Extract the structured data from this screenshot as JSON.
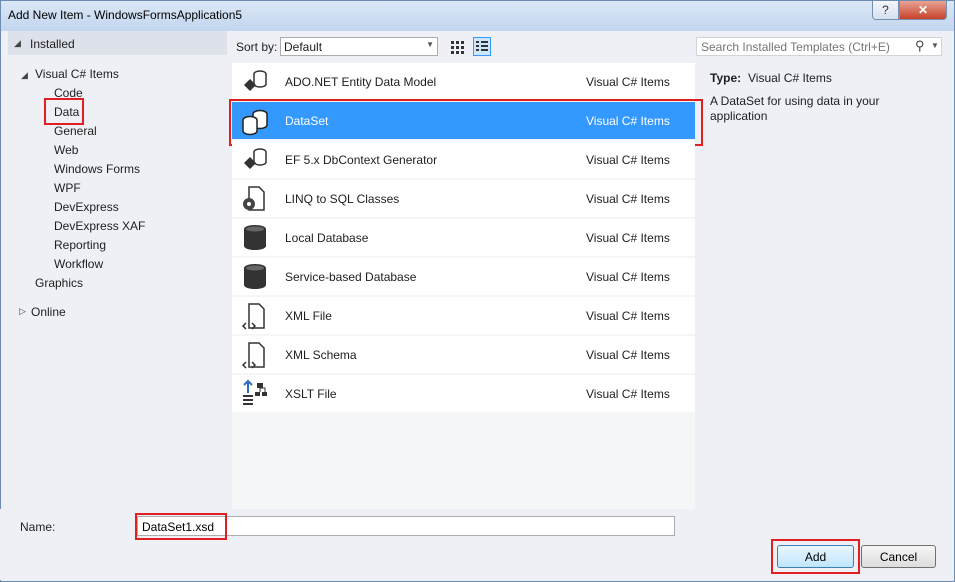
{
  "window": {
    "title": "Add New Item - WindowsFormsApplication5",
    "help_label": "?",
    "close_label": "✕"
  },
  "tree": {
    "installed": "Installed",
    "visual_csharp_items": "Visual C# Items",
    "children": [
      "Code",
      "Data",
      "General",
      "Web",
      "Windows Forms",
      "WPF",
      "DevExpress",
      "DevExpress XAF",
      "Reporting",
      "Workflow"
    ],
    "graphics": "Graphics",
    "online": "Online",
    "selected": "Data"
  },
  "toolbar": {
    "sort_label": "Sort by:",
    "sort_value": "Default"
  },
  "search": {
    "placeholder": "Search Installed Templates (Ctrl+E)"
  },
  "templates": [
    {
      "name": "ADO.NET Entity Data Model",
      "category": "Visual C# Items",
      "icon": "entity-model-icon"
    },
    {
      "name": "DataSet",
      "category": "Visual C# Items",
      "icon": "dataset-icon",
      "selected": true
    },
    {
      "name": "EF 5.x DbContext Generator",
      "category": "Visual C# Items",
      "icon": "entity-model-icon"
    },
    {
      "name": "LINQ to SQL Classes",
      "category": "Visual C# Items",
      "icon": "linq-icon"
    },
    {
      "name": "Local Database",
      "category": "Visual C# Items",
      "icon": "database-icon"
    },
    {
      "name": "Service-based Database",
      "category": "Visual C# Items",
      "icon": "database-icon"
    },
    {
      "name": "XML File",
      "category": "Visual C# Items",
      "icon": "xml-file-icon"
    },
    {
      "name": "XML Schema",
      "category": "Visual C# Items",
      "icon": "xml-file-icon"
    },
    {
      "name": "XSLT File",
      "category": "Visual C# Items",
      "icon": "xslt-icon"
    }
  ],
  "details": {
    "type_label": "Type:",
    "type_value": "Visual C# Items",
    "description": "A DataSet for using data in your application"
  },
  "name_field": {
    "label": "Name:",
    "value": "DataSet1.xsd"
  },
  "buttons": {
    "add": "Add",
    "cancel": "Cancel"
  },
  "colors": {
    "selection": "#3399ff",
    "highlight_box": "#e02020"
  }
}
